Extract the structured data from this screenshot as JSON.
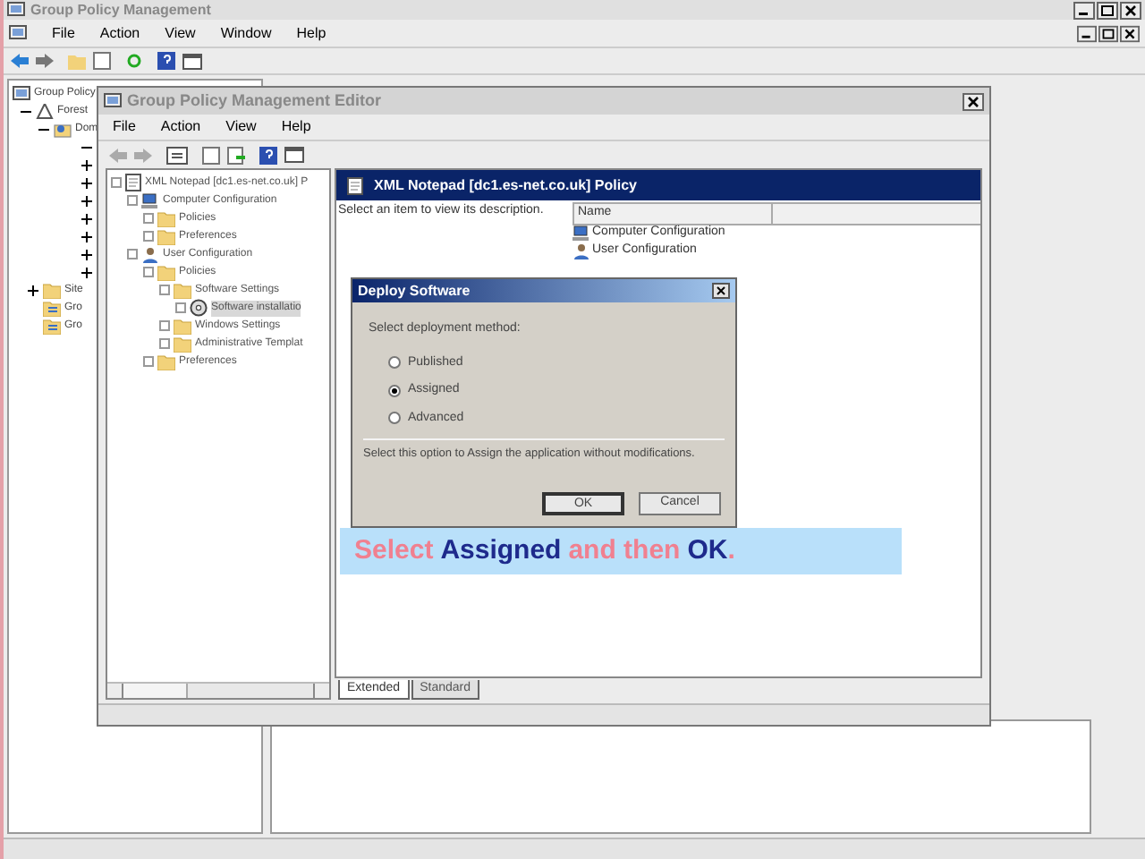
{
  "window": {
    "title": "Group Policy Management",
    "menu": [
      "File",
      "Action",
      "View",
      "Window",
      "Help"
    ]
  },
  "outer_tree": [
    {
      "label": "Group Policy",
      "kind": "console"
    },
    {
      "label": "Forest",
      "kind": "forest",
      "expanded": true
    },
    {
      "label": "Dom",
      "kind": "domain",
      "expanded": true
    },
    {
      "kind": "hidden",
      "expanded": true
    },
    {
      "kind": "hidden",
      "expanded": false
    },
    {
      "kind": "hidden",
      "expanded": false
    },
    {
      "kind": "hidden",
      "expanded": false
    },
    {
      "kind": "hidden",
      "expanded": false
    },
    {
      "kind": "hidden",
      "expanded": false
    },
    {
      "kind": "hidden",
      "expanded": false
    },
    {
      "kind": "hidden",
      "expanded": false
    },
    {
      "label": "Site",
      "kind": "folder",
      "expanded": false
    },
    {
      "label": "Gro",
      "kind": "gpo"
    },
    {
      "label": "Gro",
      "kind": "gpo"
    }
  ],
  "editor": {
    "title": "Group Policy Management Editor",
    "menu": [
      "File",
      "Action",
      "View",
      "Help"
    ],
    "tree": [
      {
        "label": "XML Notepad [dc1.es-net.co.uk] P",
        "kind": "policy",
        "selected": false,
        "children": [
          {
            "label": "Computer Configuration",
            "kind": "computer",
            "selected": false,
            "children": [
              {
                "label": "Policies",
                "kind": "folder",
                "selected": false
              },
              {
                "label": "Preferences",
                "kind": "folder",
                "selected": false
              }
            ]
          },
          {
            "label": "User Configuration",
            "kind": "user",
            "selected": false,
            "children": [
              {
                "label": "Policies",
                "kind": "folder",
                "selected": false,
                "children": [
                  {
                    "label": "Software Settings",
                    "kind": "folder",
                    "selected": false,
                    "children": [
                      {
                        "label": "Software installatio",
                        "kind": "package",
                        "selected": true
                      }
                    ]
                  },
                  {
                    "label": "Windows Settings",
                    "kind": "folder",
                    "selected": false
                  },
                  {
                    "label": "Administrative Templat",
                    "kind": "folder",
                    "selected": false
                  }
                ]
              },
              {
                "label": "Preferences",
                "kind": "folder",
                "selected": false
              }
            ]
          }
        ]
      }
    ],
    "header": "XML Notepad [dc1.es-net.co.uk] Policy",
    "description": "Select an item to view its description.",
    "list": {
      "columns": [
        "Name"
      ],
      "rows": [
        {
          "name": "Computer Configuration",
          "kind": "computer"
        },
        {
          "name": "User Configuration",
          "kind": "user"
        }
      ]
    },
    "tabs": [
      {
        "label": "Extended",
        "selected": true
      },
      {
        "label": "Standard",
        "selected": false
      }
    ]
  },
  "dialog": {
    "title": "Deploy Software",
    "prompt": "Select deployment method:",
    "options": [
      {
        "label": "Published",
        "selected": false
      },
      {
        "label": "Assigned",
        "selected": true
      },
      {
        "label": "Advanced",
        "selected": false
      }
    ],
    "hint": "Select this option to Assign the application without modifications.",
    "buttons": [
      {
        "label": "OK",
        "kind": "default"
      },
      {
        "label": "Cancel",
        "kind": "normal"
      }
    ]
  },
  "callout": [
    {
      "text": "Select",
      "kind": "plain"
    },
    {
      "text": "Assigned",
      "kind": "key"
    },
    {
      "text": "and then",
      "kind": "plain"
    },
    {
      "text": "OK",
      "kind": "key"
    },
    {
      "text": ".",
      "kind": "plain"
    }
  ]
}
